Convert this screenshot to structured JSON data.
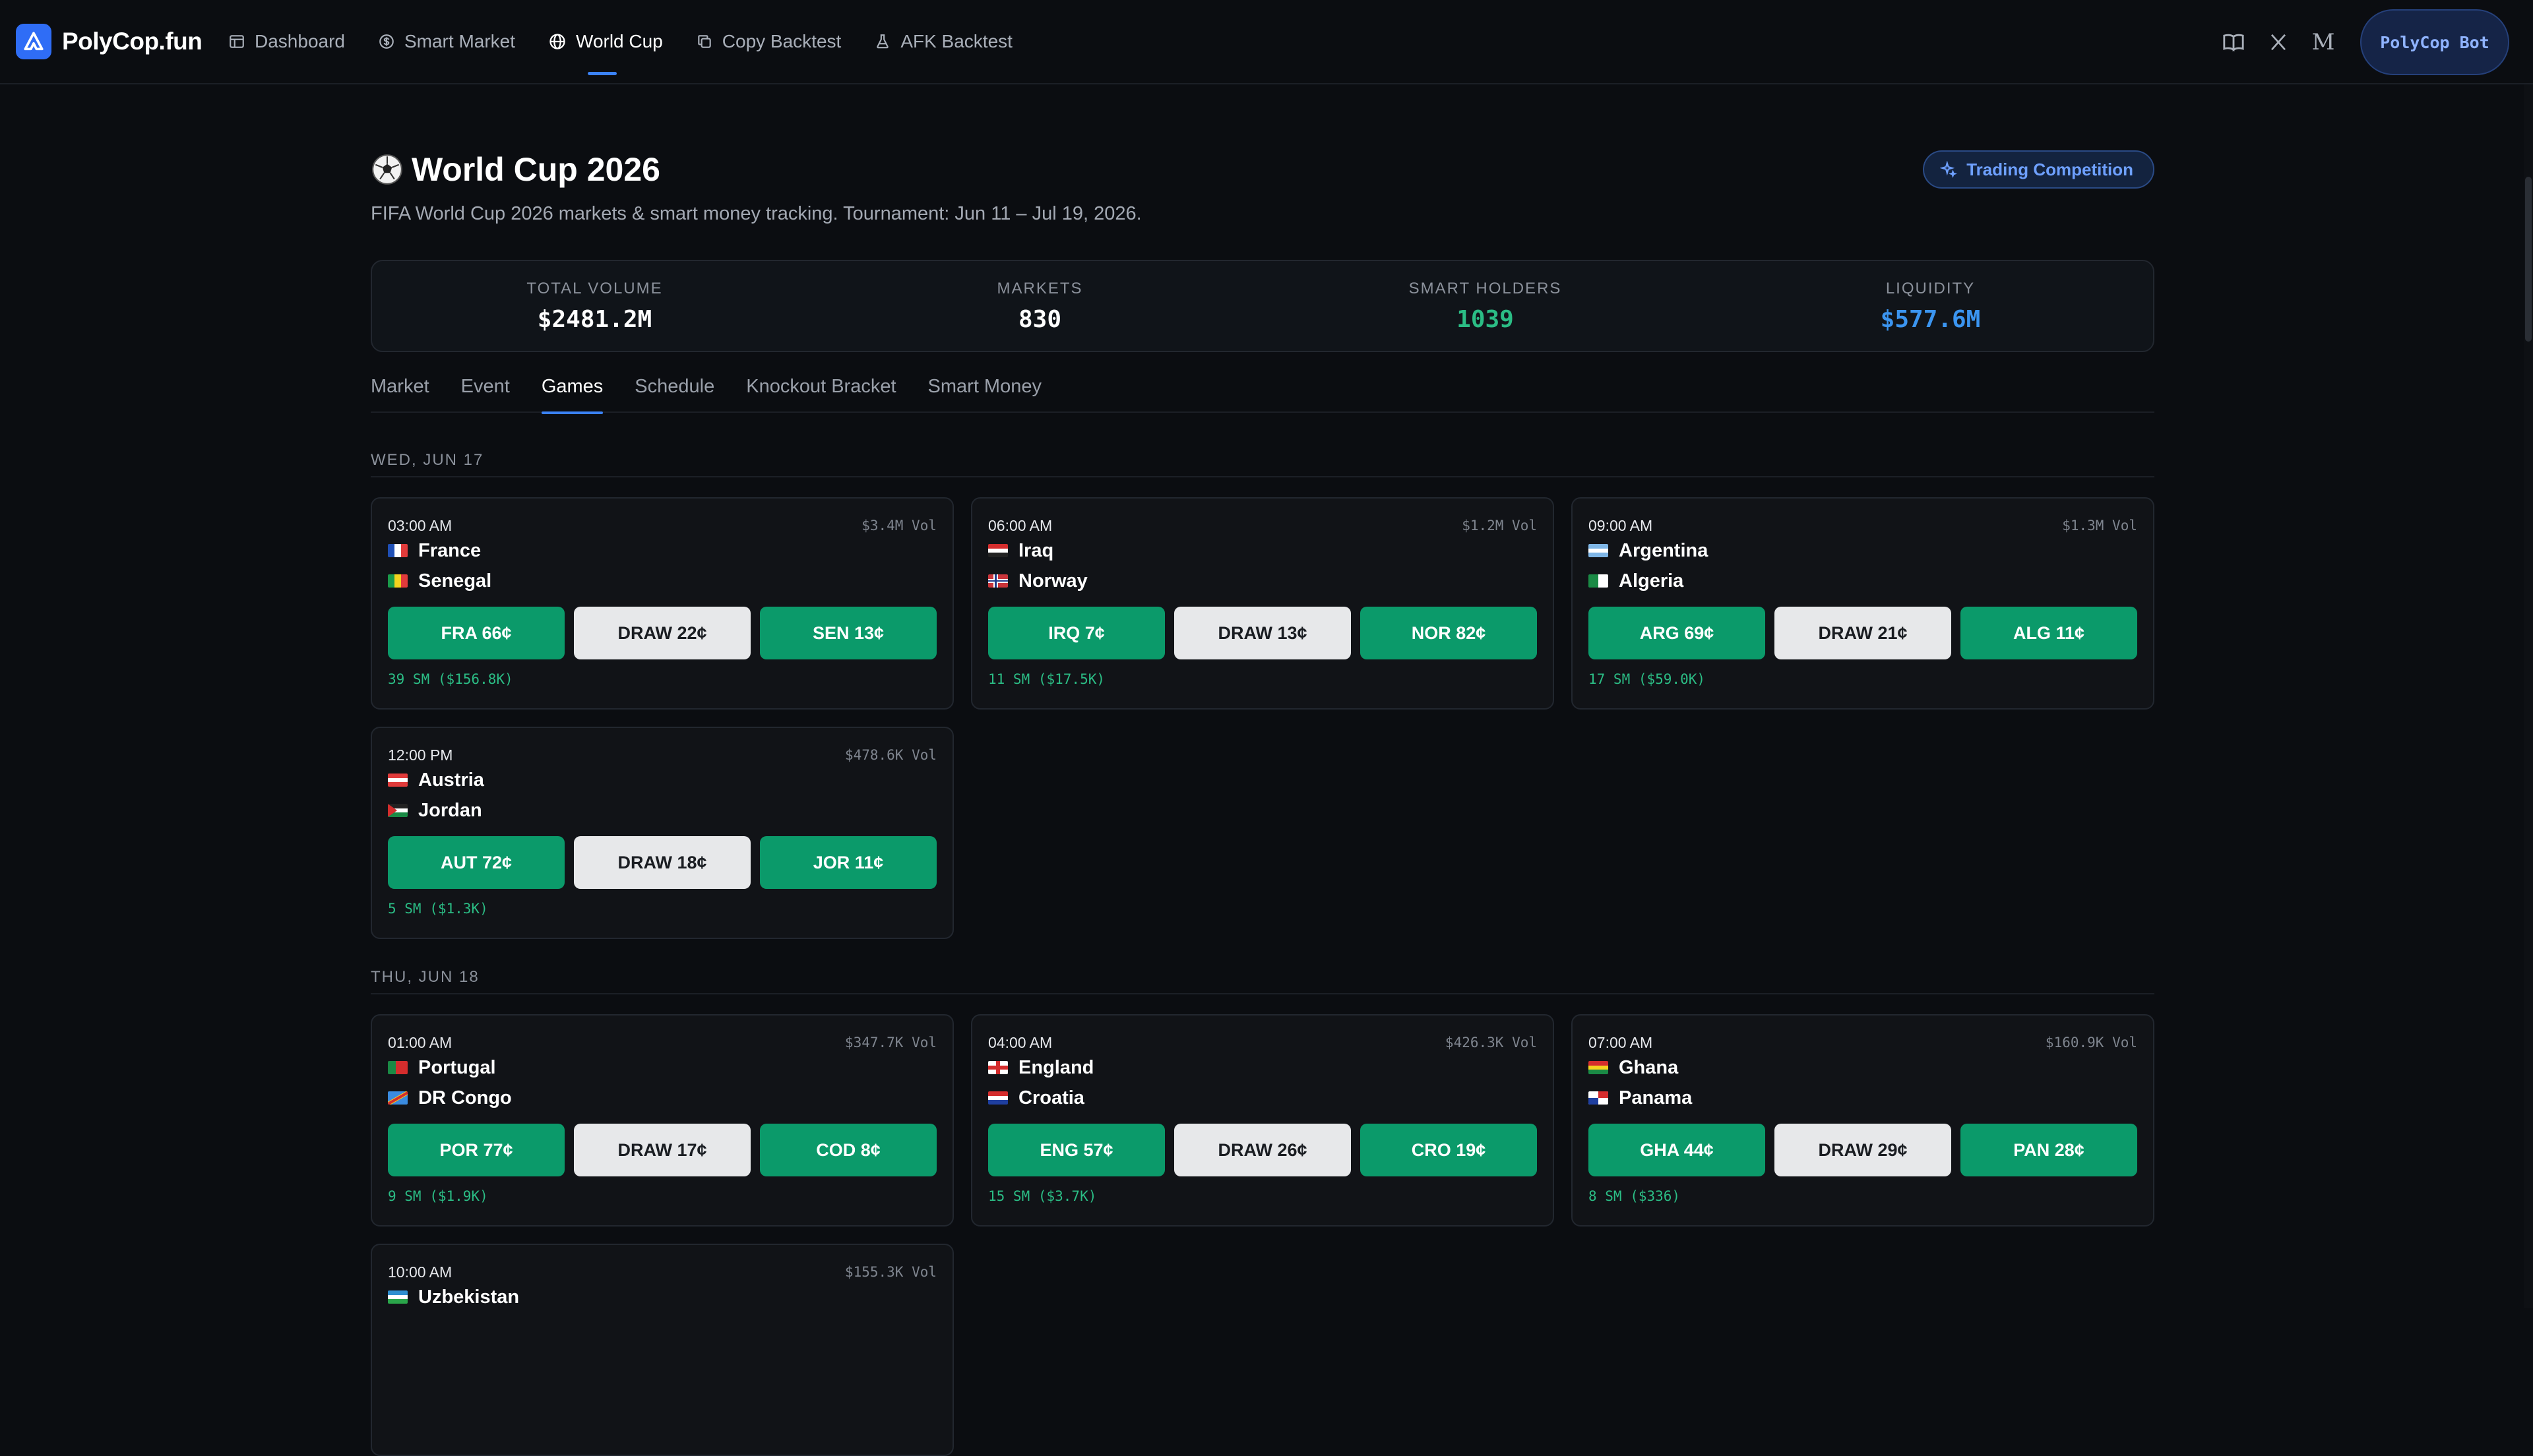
{
  "nav": {
    "brand": "PolyCop.fun",
    "links": [
      {
        "label": "Dashboard",
        "icon": "dashboard-icon"
      },
      {
        "label": "Smart Market",
        "icon": "dollar-icon"
      },
      {
        "label": "World Cup",
        "icon": "globe-icon",
        "active": true
      },
      {
        "label": "Copy Backtest",
        "icon": "copy-icon"
      },
      {
        "label": "AFK Backtest",
        "icon": "flask-icon"
      }
    ],
    "right_icons": [
      "book-icon",
      "x-icon",
      "medium-icon"
    ],
    "medium_glyph": "M",
    "bot_button": "PolyCop Bot"
  },
  "header": {
    "title": "World Cup 2026",
    "subtitle": "FIFA World Cup 2026 markets & smart money tracking. Tournament: Jun 11 – Jul 19, 2026.",
    "trading_button": "Trading Competition"
  },
  "stats": [
    {
      "label": "TOTAL VOLUME",
      "value": "$2481.2M",
      "color": "#ffffff"
    },
    {
      "label": "MARKETS",
      "value": "830",
      "color": "#ffffff"
    },
    {
      "label": "SMART HOLDERS",
      "value": "1039",
      "color": "#2bbd85"
    },
    {
      "label": "LIQUIDITY",
      "value": "$577.6M",
      "color": "#3b95f0"
    }
  ],
  "tabs": [
    {
      "label": "Market"
    },
    {
      "label": "Event"
    },
    {
      "label": "Games",
      "active": true
    },
    {
      "label": "Schedule"
    },
    {
      "label": "Knockout Bracket"
    },
    {
      "label": "Smart Money"
    }
  ],
  "days": [
    {
      "label": "WED, JUN 17",
      "games": [
        {
          "time": "03:00 AM",
          "vol": "$3.4M Vol",
          "home": "France",
          "away": "Senegal",
          "home_odds": "FRA 66¢",
          "draw_odds": "DRAW 22¢",
          "away_odds": "SEN 13¢",
          "sm": "39 SM ($156.8K)"
        },
        {
          "time": "06:00 AM",
          "vol": "$1.2M Vol",
          "home": "Iraq",
          "away": "Norway",
          "home_odds": "IRQ 7¢",
          "draw_odds": "DRAW 13¢",
          "away_odds": "NOR 82¢",
          "sm": "11 SM ($17.5K)"
        },
        {
          "time": "09:00 AM",
          "vol": "$1.3M Vol",
          "home": "Argentina",
          "away": "Algeria",
          "home_odds": "ARG 69¢",
          "draw_odds": "DRAW 21¢",
          "away_odds": "ALG 11¢",
          "sm": "17 SM ($59.0K)"
        },
        {
          "time": "12:00 PM",
          "vol": "$478.6K Vol",
          "home": "Austria",
          "away": "Jordan",
          "home_odds": "AUT 72¢",
          "draw_odds": "DRAW 18¢",
          "away_odds": "JOR 11¢",
          "sm": "5 SM ($1.3K)"
        }
      ]
    },
    {
      "label": "THU, JUN 18",
      "games": [
        {
          "time": "01:00 AM",
          "vol": "$347.7K Vol",
          "home": "Portugal",
          "away": "DR Congo",
          "home_odds": "POR 77¢",
          "draw_odds": "DRAW 17¢",
          "away_odds": "COD 8¢",
          "sm": "9 SM ($1.9K)"
        },
        {
          "time": "04:00 AM",
          "vol": "$426.3K Vol",
          "home": "England",
          "away": "Croatia",
          "home_odds": "ENG 57¢",
          "draw_odds": "DRAW 26¢",
          "away_odds": "CRO 19¢",
          "sm": "15 SM ($3.7K)"
        },
        {
          "time": "07:00 AM",
          "vol": "$160.9K Vol",
          "home": "Ghana",
          "away": "Panama",
          "home_odds": "GHA 44¢",
          "draw_odds": "DRAW 29¢",
          "away_odds": "PAN 28¢",
          "sm": "8 SM ($336)"
        },
        {
          "time": "10:00 AM",
          "vol": "$155.3K Vol",
          "home": "Uzbekistan",
          "away": "",
          "home_odds": "",
          "draw_odds": "",
          "away_odds": "",
          "sm": ""
        }
      ]
    }
  ],
  "colors": {
    "accent": "#3b82f6",
    "buy_green": "#0b9a6a",
    "draw_gray": "#e7e8ea",
    "smart_green": "#2bbd85"
  }
}
